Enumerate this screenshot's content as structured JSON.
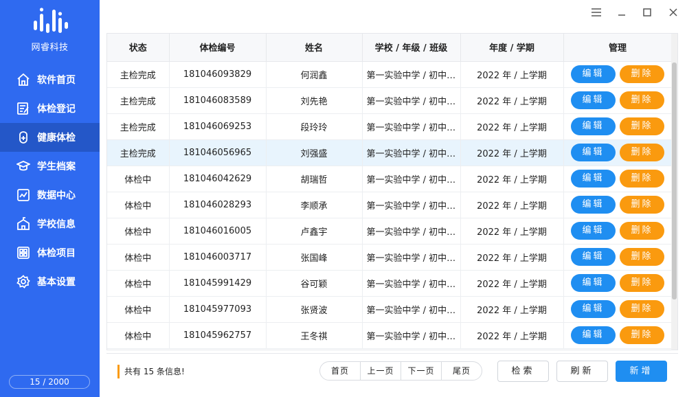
{
  "app": {
    "name": "网睿科技",
    "counter": "15 / 2000"
  },
  "nav": [
    {
      "label": "软件首页",
      "icon": "home-icon",
      "active": false
    },
    {
      "label": "体检登记",
      "icon": "register-icon",
      "active": false
    },
    {
      "label": "健康体检",
      "icon": "health-check-icon",
      "active": true
    },
    {
      "label": "学生档案",
      "icon": "graduation-cap-icon",
      "active": false
    },
    {
      "label": "数据中心",
      "icon": "chart-icon",
      "active": false
    },
    {
      "label": "学校信息",
      "icon": "school-icon",
      "active": false
    },
    {
      "label": "体检项目",
      "icon": "grid-icon",
      "active": false
    },
    {
      "label": "基本设置",
      "icon": "gear-icon",
      "active": false
    }
  ],
  "table": {
    "headers": [
      "状态",
      "体检编号",
      "姓名",
      "学校 / 年级 / 班级",
      "年度 / 学期",
      "管理"
    ],
    "rows": [
      {
        "status": "主检完成",
        "id": "181046093829",
        "name": "何润鑫",
        "school": "第一实验中学 / 初中一年级 / 一班",
        "term": "2022 年 / 上学期",
        "highlight": false
      },
      {
        "status": "主检完成",
        "id": "181046083589",
        "name": "刘先艳",
        "school": "第一实验中学 / 初中一年级 / 一班",
        "term": "2022 年 / 上学期",
        "highlight": false
      },
      {
        "status": "主检完成",
        "id": "181046069253",
        "name": "段玲玲",
        "school": "第一实验中学 / 初中一年级 / 一班",
        "term": "2022 年 / 上学期",
        "highlight": false
      },
      {
        "status": "主检完成",
        "id": "181046056965",
        "name": "刘强盛",
        "school": "第一实验中学 / 初中一年级 / 一班",
        "term": "2022 年 / 上学期",
        "highlight": true
      },
      {
        "status": "体检中",
        "id": "181046042629",
        "name": "胡瑞哲",
        "school": "第一实验中学 / 初中一年级 / 一班",
        "term": "2022 年 / 上学期",
        "highlight": false
      },
      {
        "status": "体检中",
        "id": "181046028293",
        "name": "李顺承",
        "school": "第一实验中学 / 初中一年级 / 一班",
        "term": "2022 年 / 上学期",
        "highlight": false
      },
      {
        "status": "体检中",
        "id": "181046016005",
        "name": "卢鑫宇",
        "school": "第一实验中学 / 初中一年级 / 一班",
        "term": "2022 年 / 上学期",
        "highlight": false
      },
      {
        "status": "体检中",
        "id": "181046003717",
        "name": "张国峰",
        "school": "第一实验中学 / 初中一年级 / 一班",
        "term": "2022 年 / 上学期",
        "highlight": false
      },
      {
        "status": "体检中",
        "id": "181045991429",
        "name": "谷可颖",
        "school": "第一实验中学 / 初中一年级 / 一班",
        "term": "2022 年 / 上学期",
        "highlight": false
      },
      {
        "status": "体检中",
        "id": "181045977093",
        "name": "张贤波",
        "school": "第一实验中学 / 初中一年级 / 一班",
        "term": "2022 年 / 上学期",
        "highlight": false
      },
      {
        "status": "体检中",
        "id": "181045962757",
        "name": "王冬祺",
        "school": "第一实验中学 / 初中一年级 / 一班",
        "term": "2022 年 / 上学期",
        "highlight": false
      }
    ],
    "edit_label": "编辑",
    "delete_label": "删除"
  },
  "footer": {
    "total_prefix": "共有",
    "total_count": "15",
    "total_suffix": "条信息!",
    "pager": [
      "首页",
      "上一页",
      "下一页",
      "尾页"
    ],
    "search_label": "检索",
    "refresh_label": "刷新",
    "add_label": "新增"
  },
  "colors": {
    "sidebar": "#2f6af0",
    "active": "#2457c8",
    "edit": "#1f8ef1",
    "delete": "#fa9a0f"
  }
}
